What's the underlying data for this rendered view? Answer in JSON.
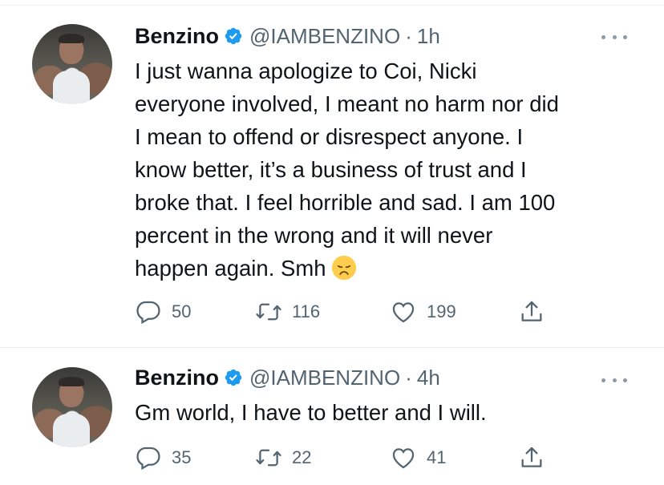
{
  "tweets": [
    {
      "author": {
        "name": "Benzino",
        "handle": "@IAMBENZINO",
        "verified": true
      },
      "time": "1h",
      "separator": "·",
      "text_lines": [
        "I just wanna apologize to Coi, Nicki",
        "everyone involved, I meant no harm nor did",
        "I mean to offend or disrespect anyone. I",
        "know better, it’s a business of trust and I",
        "broke that. I feel horrible and sad. I am 100",
        "percent in the wrong and it will never",
        "happen again. Smh"
      ],
      "emoji": "disappointed-face",
      "stats": {
        "replies": "50",
        "retweets": "116",
        "likes": "199"
      }
    },
    {
      "author": {
        "name": "Benzino",
        "handle": "@IAMBENZINO",
        "verified": true
      },
      "time": "4h",
      "separator": "·",
      "text_lines": [
        "Gm world, I have to better and I will."
      ],
      "stats": {
        "replies": "35",
        "retweets": "22",
        "likes": "41"
      }
    }
  ],
  "colors": {
    "text": "#0f1419",
    "secondary": "#536471",
    "verified": "#1d9bf0",
    "divider": "#eff3f4"
  },
  "icons": [
    "verified-badge-icon",
    "more-icon",
    "reply-icon",
    "retweet-icon",
    "like-icon",
    "share-icon",
    "disappointed-face-emoji"
  ]
}
